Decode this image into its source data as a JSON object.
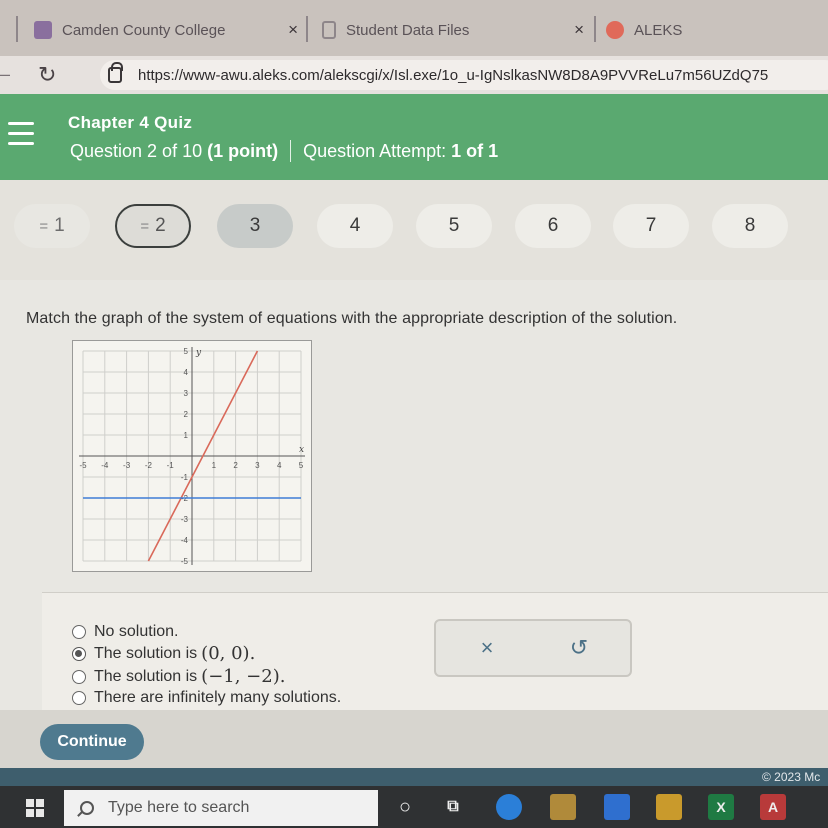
{
  "browser": {
    "tabs": [
      {
        "title": "Camden County College",
        "color": "#8a6f9e"
      },
      {
        "title": "Student Data Files",
        "color": "#8e868a"
      },
      {
        "title": "ALEKS",
        "color": "#e06a5a"
      }
    ],
    "close_glyph": "×",
    "url": "https://www-awu.aleks.com/alekscgi/x/Isl.exe/1o_u-IgNslkasNW8D8A9PVVReLu7m56UZdQ75"
  },
  "header": {
    "quiz_title": "Chapter 4 Quiz",
    "question_label": "Question 2 of 10",
    "points": "(1 point)",
    "attempt_label": "Question Attempt:",
    "attempt_value": "1 of 1"
  },
  "question_nav": [
    "1",
    "2",
    "3",
    "4",
    "5",
    "6",
    "7",
    "8"
  ],
  "question": {
    "prompt": "Match the graph of the system of equations with the appropriate description of the solution.",
    "graph": {
      "x_label": "x",
      "y_label": "y",
      "x_ticks": [
        "-5",
        "-4",
        "-3",
        "-2",
        "-1",
        "1",
        "2",
        "3",
        "4",
        "5"
      ],
      "y_ticks": [
        "5",
        "4",
        "3",
        "2",
        "1",
        "-1",
        "-2",
        "-3",
        "-4",
        "-5"
      ],
      "xlim": [
        -5,
        5
      ],
      "ylim": [
        -5,
        5
      ],
      "lines": [
        {
          "points": [
            [
              -2,
              -5
            ],
            [
              3,
              5
            ]
          ],
          "color": "#d9695a"
        },
        {
          "points": [
            [
              -5,
              -2
            ],
            [
              5,
              -2
            ]
          ],
          "color": "#3e7dd6"
        }
      ]
    },
    "choices": [
      {
        "text": "No solution.",
        "math": "",
        "checked": false
      },
      {
        "text": "The solution is",
        "math": "(0, 0).",
        "checked": true
      },
      {
        "text": "The solution is",
        "math": "(−1, −2).",
        "checked": false
      },
      {
        "text": "There are infinitely many solutions.",
        "math": "",
        "checked": false
      }
    ],
    "clear_glyph": "×",
    "undo_glyph": "↺"
  },
  "continue_label": "Continue",
  "copyright": "© 2023 Mc",
  "taskbar": {
    "search_placeholder": "Type here to search"
  }
}
